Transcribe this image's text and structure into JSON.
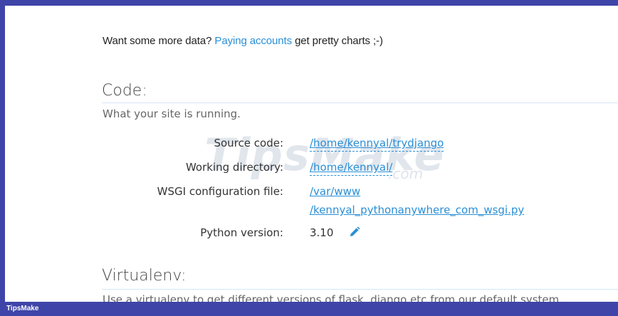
{
  "promo": {
    "prefix": "Want some more data? ",
    "link": "Paying accounts",
    "suffix": " get pretty charts ;-)"
  },
  "code_section": {
    "title": "Code:",
    "subtitle": "What your site is running.",
    "rows": {
      "source_code": {
        "label": "Source code:",
        "value": "/home/kennyal/trydjango"
      },
      "working_directory": {
        "label": "Working directory:",
        "value": "/home/kennyal/"
      },
      "wsgi": {
        "label": "WSGI configuration file:",
        "value_line1": "/var/www",
        "value_line2": "/kennyal_pythonanywhere_com_wsgi.py"
      },
      "python_version": {
        "label": "Python version:",
        "value": "3.10"
      }
    }
  },
  "virtualenv_section": {
    "title": "Virtualenv:",
    "description_cut": "Use a virtualenv to get different versions of flask, django etc from our default system"
  },
  "watermark": {
    "text": "TipsMake",
    "suffix": ".com"
  },
  "footer": {
    "brand": "TipsMake"
  },
  "colors": {
    "accent": "#2a8fd6",
    "frame": "#3f45a8"
  }
}
